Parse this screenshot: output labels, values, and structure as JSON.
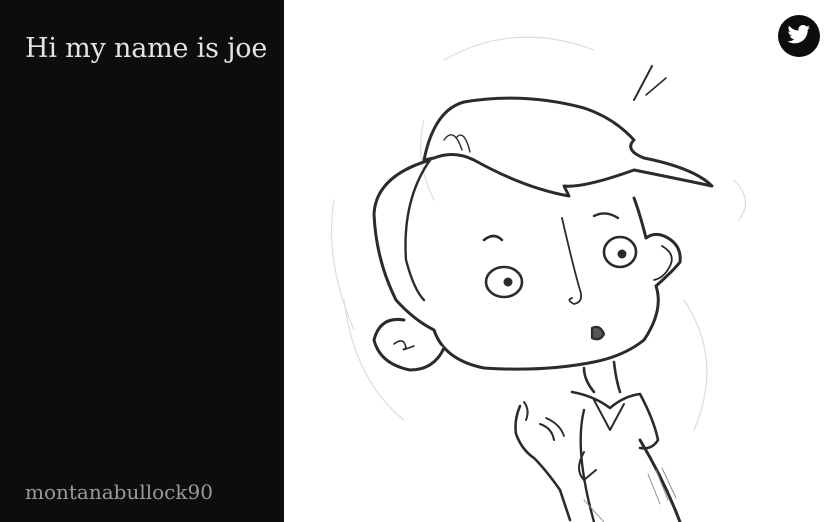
{
  "page": {
    "title": "Hi my name is joe",
    "username": "montanabullock90"
  },
  "artwork": {
    "subject": "pencil-sketch-boy-character"
  },
  "share": {
    "icon": "twitter-bird-icon"
  },
  "colors": {
    "sidebar_bg": "#0d0d0d",
    "title_text": "#e3e3e3",
    "username_text": "#9a9a9a",
    "canvas_bg": "#ffffff"
  }
}
